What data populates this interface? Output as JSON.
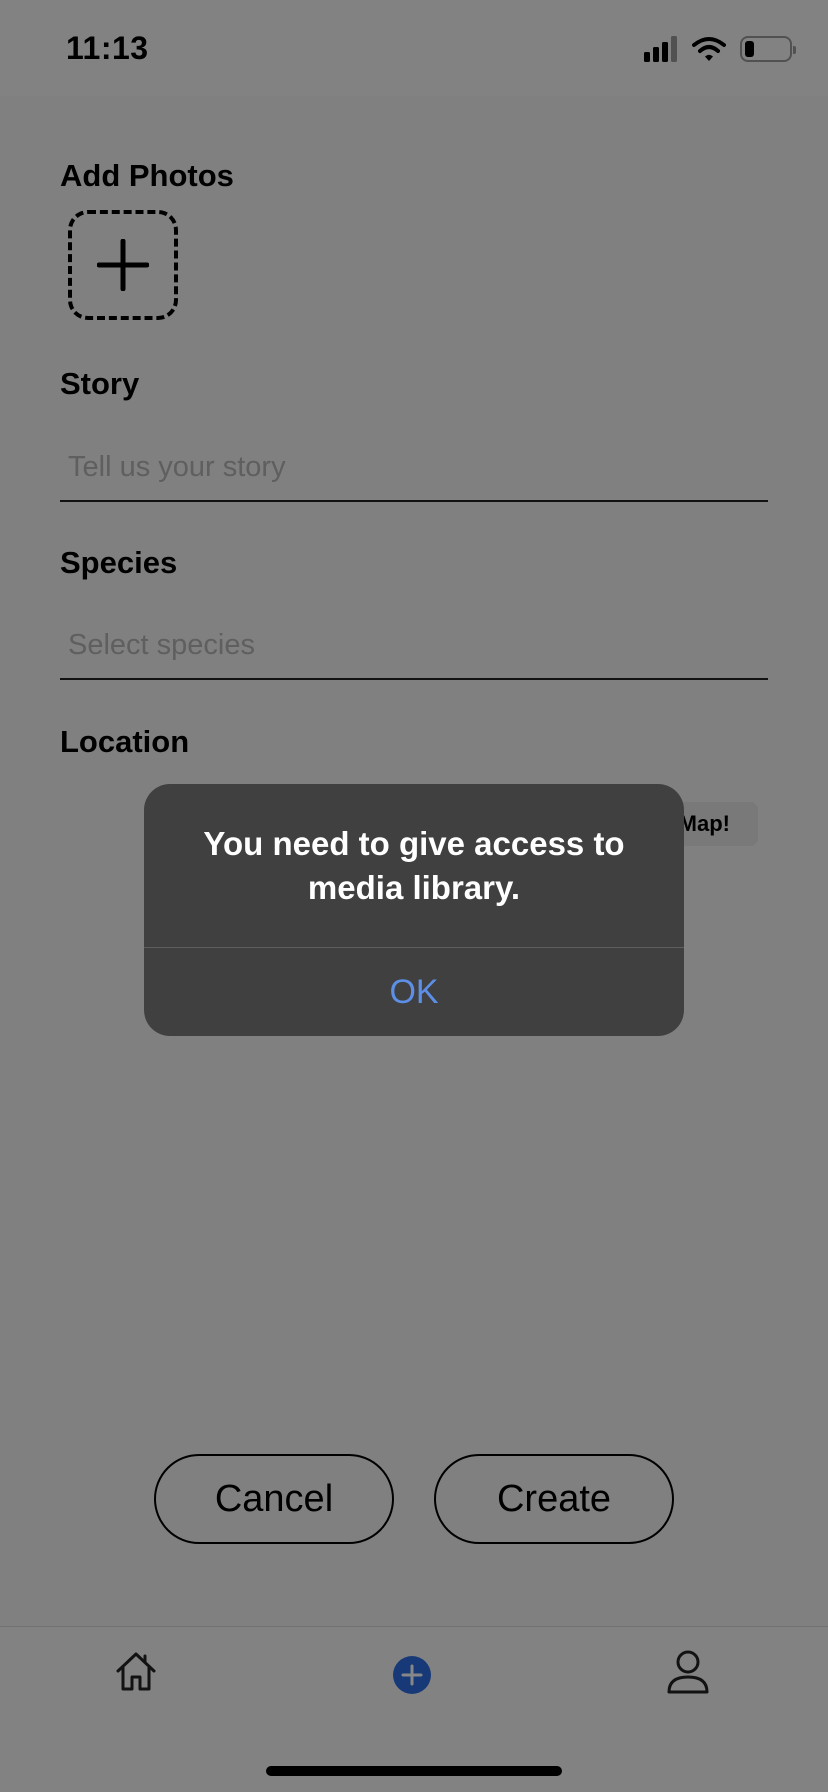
{
  "status_bar": {
    "time": "11:13",
    "battery_level": 0.2
  },
  "form": {
    "photos_label": "Add Photos",
    "story_label": "Story",
    "story_placeholder": "Tell us your story",
    "species_label": "Species",
    "species_placeholder": "Select species",
    "location_label": "Location",
    "map_button_label": "Map!"
  },
  "actions": {
    "cancel_label": "Cancel",
    "create_label": "Create"
  },
  "alert": {
    "message": "You need to give access to media library.",
    "ok_label": "OK"
  },
  "tab_bar": {
    "tabs": [
      {
        "icon": "home-icon",
        "active": false
      },
      {
        "icon": "add-circle-icon",
        "active": true
      },
      {
        "icon": "profile-icon",
        "active": false
      }
    ],
    "accent_color": "#2f6de1"
  },
  "colors": {
    "alert_button": "#5d8fe6",
    "alert_background": "#404040"
  }
}
